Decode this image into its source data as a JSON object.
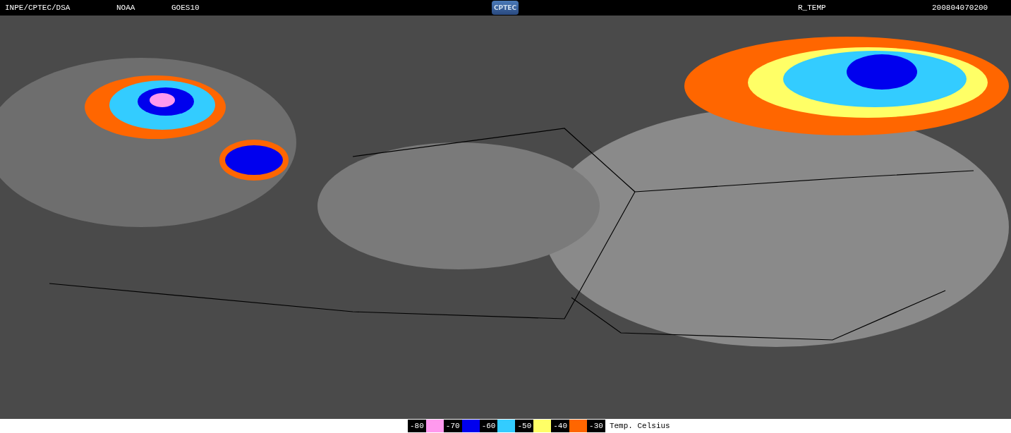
{
  "header": {
    "source": "INPE/CPTEC/DSA",
    "agency": "NOAA",
    "satellite": "GOES10",
    "logo": "CPTEC",
    "product": "R_TEMP",
    "timestamp": "200804070200"
  },
  "legend": {
    "entries": [
      {
        "label": "-80",
        "color": "#ff99ee"
      },
      {
        "label": "-70",
        "color": "#0000ee"
      },
      {
        "label": "-60",
        "color": "#33ccff"
      },
      {
        "label": "-50",
        "color": "#ffff66"
      },
      {
        "label": "-40",
        "color": "#ff6600"
      },
      {
        "label": "-30"
      }
    ],
    "unit": "Temp. Celsius"
  }
}
